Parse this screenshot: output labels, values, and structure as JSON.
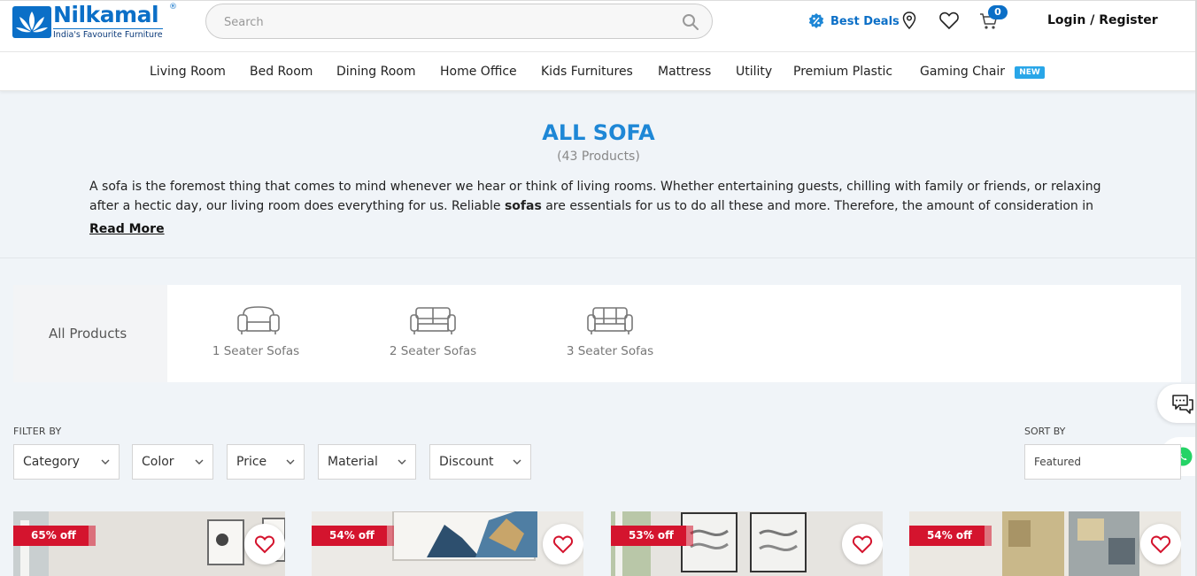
{
  "header": {
    "logo_name": "Nilkamal",
    "logo_reg": "®",
    "logo_tagline": "India's Favourite Furniture",
    "search_placeholder": "Search",
    "deals_label": "Best Deals",
    "cart_count": "0",
    "login_label": "Login / Register"
  },
  "nav": {
    "items": [
      "Living Room",
      "Bed Room",
      "Dining Room",
      "Home Office",
      "Kids Furnitures",
      "Mattress",
      "Utility",
      "Premium Plastic",
      "Gaming Chair"
    ],
    "new_badge": "NEW"
  },
  "intro": {
    "title": "ALL SOFA",
    "count": "(43 Products)",
    "text_before": "A sofa is the foremost thing that comes to mind whenever we hear or think of living rooms. Whether entertaining guests, chilling with family or friends, or relaxing after a hectic day, our living room does everything for us. Reliable ",
    "text_bold": "sofas",
    "text_after": " are essentials for us to do all these and more. Therefore, the amount of consideration in",
    "read_more": "Read More"
  },
  "categories": {
    "all_label": "All Products",
    "items": [
      "1 Seater Sofas",
      "2 Seater Sofas",
      "3 Seater Sofas"
    ]
  },
  "filters": {
    "label": "FILTER BY",
    "items": [
      "Category",
      "Color",
      "Price",
      "Material",
      "Discount"
    ],
    "sort_label": "SORT BY",
    "sort_value": "Featured"
  },
  "products": [
    {
      "discount": "65% off"
    },
    {
      "discount": "54% off"
    },
    {
      "discount": "53% off"
    },
    {
      "discount": "54% off"
    }
  ],
  "colors": {
    "brand_blue": "#0b6fc7",
    "title_blue": "#1e87d6",
    "discount_red": "#d4142e",
    "whatsapp_green": "#25d366"
  }
}
